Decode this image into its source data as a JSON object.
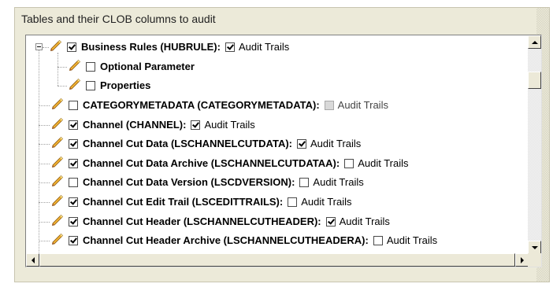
{
  "panel": {
    "title": "Tables and their CLOB columns to audit"
  },
  "tree": {
    "rows": [
      {
        "label": "Business Rules (HUBRULE):",
        "checked": true,
        "audit_label": "Audit Trails",
        "audit_checked": true,
        "audit_enabled": true
      },
      {
        "label": "Optional Parameter",
        "checked": false
      },
      {
        "label": "Properties",
        "checked": false
      },
      {
        "label": "CATEGORYMETADATA (CATEGORYMETADATA):",
        "checked": false,
        "audit_label": "Audit Trails",
        "audit_checked": false,
        "audit_enabled": false
      },
      {
        "label": "Channel (CHANNEL):",
        "checked": true,
        "audit_label": "Audit Trails",
        "audit_checked": true,
        "audit_enabled": true
      },
      {
        "label": "Channel Cut Data (LSCHANNELCUTDATA):",
        "checked": true,
        "audit_label": "Audit Trails",
        "audit_checked": true,
        "audit_enabled": true
      },
      {
        "label": "Channel Cut Data Archive (LSCHANNELCUTDATAA):",
        "checked": true,
        "audit_label": "Audit Trails",
        "audit_checked": false,
        "audit_enabled": true
      },
      {
        "label": "Channel Cut Data Version (LSCDVERSION):",
        "checked": false,
        "audit_label": "Audit Trails",
        "audit_checked": false,
        "audit_enabled": true
      },
      {
        "label": "Channel Cut Edit Trail (LSCEDITTRAILS):",
        "checked": true,
        "audit_label": "Audit Trails",
        "audit_checked": false,
        "audit_enabled": true
      },
      {
        "label": "Channel Cut Header (LSCHANNELCUTHEADER):",
        "checked": true,
        "audit_label": "Audit Trails",
        "audit_checked": true,
        "audit_enabled": true
      },
      {
        "label": "Channel Cut Header Archive (LSCHANNELCUTHEADERA):",
        "checked": true,
        "audit_label": "Audit Trails",
        "audit_checked": false,
        "audit_enabled": true
      }
    ]
  },
  "icons": {
    "edit": "pencil-icon",
    "collapse": "minus-icon"
  },
  "colors": {
    "panel_bg": "#ecead9",
    "pencil_body": "#f2b233",
    "pencil_tip": "#a0522d"
  }
}
